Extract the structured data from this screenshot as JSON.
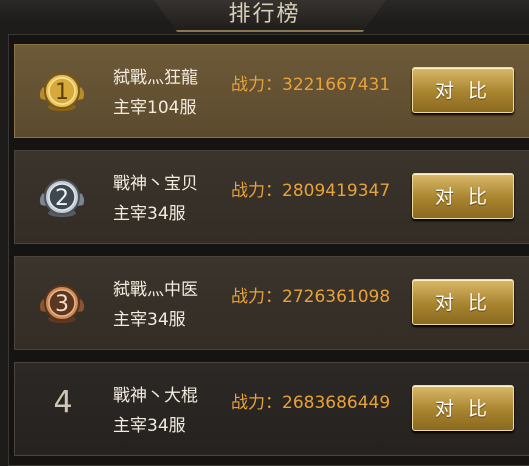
{
  "header": {
    "title": "排行榜"
  },
  "rows": [
    {
      "rank": "1",
      "name": "弑戰灬狂龍",
      "server": "主宰104服",
      "power_label": "战力：",
      "power_value": "3221667431",
      "compare_label": "对 比",
      "medal": "gold"
    },
    {
      "rank": "2",
      "name": "戰神丶宝贝",
      "server": "主宰34服",
      "power_label": "战力：",
      "power_value": "2809419347",
      "compare_label": "对 比",
      "medal": "silver"
    },
    {
      "rank": "3",
      "name": "弑戰灬中医",
      "server": "主宰34服",
      "power_label": "战力：",
      "power_value": "2726361098",
      "compare_label": "对 比",
      "medal": "bronze"
    },
    {
      "rank": "4",
      "name": "戰神丶大棍",
      "server": "主宰34服",
      "power_label": "战力：",
      "power_value": "2683686449",
      "compare_label": "对 比",
      "medal": "none"
    }
  ],
  "colors": {
    "power": "#e8a23a",
    "button_gold": "#a8842f",
    "gold_medal": "#d6a93a",
    "silver_medal": "#9aa3ad",
    "bronze_medal": "#a86a3e"
  }
}
